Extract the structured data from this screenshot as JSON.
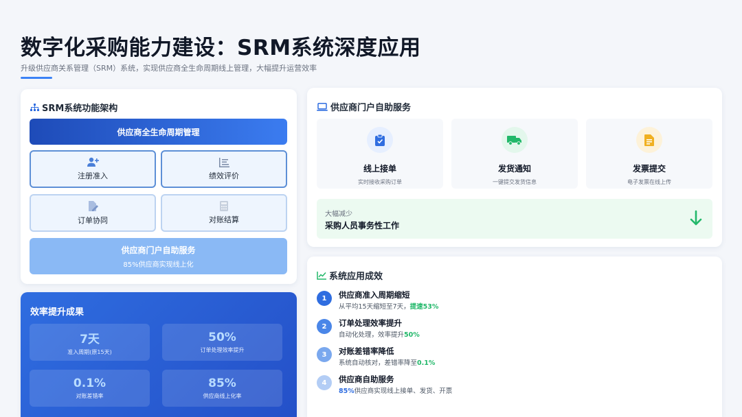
{
  "header": {
    "title": "数字化采购能力建设：SRM系统深度应用",
    "subtitle": "升级供应商关系管理（SRM）系统，实现供应商全生命周期线上管理，大幅提升运营效率"
  },
  "architecture": {
    "title": "SRM系统功能架构",
    "top_label": "供应商全生命周期管理",
    "modules": [
      {
        "label": "注册准入",
        "icon": "user-plus-icon"
      },
      {
        "label": "绩效评价",
        "icon": "list-icon"
      },
      {
        "label": "订单协同",
        "icon": "file-edit-icon"
      },
      {
        "label": "对账结算",
        "icon": "calculator-icon"
      }
    ],
    "portal_label": "供应商门户自助服务",
    "portal_sub": "85%供应商实现线上化"
  },
  "efficiency": {
    "title": "效率提升成果",
    "stats": [
      {
        "value": "7天",
        "label": "准入周期(原15天)"
      },
      {
        "value": "50%",
        "label": "订单处理效率提升"
      },
      {
        "value": "0.1%",
        "label": "对账差错率"
      },
      {
        "value": "85%",
        "label": "供应商线上化率"
      }
    ]
  },
  "portal": {
    "title": "供应商门户自助服务",
    "services": [
      {
        "name": "线上接单",
        "desc": "实时接收采购订单",
        "icon": "clipboard-check-icon",
        "color": "#2f6de0",
        "bg": "#e6efff"
      },
      {
        "name": "发货通知",
        "desc": "一键提交发货信息",
        "icon": "truck-icon",
        "color": "#22b86a",
        "bg": "#e3f7ec"
      },
      {
        "name": "发票提交",
        "desc": "电子发票在线上传",
        "icon": "invoice-icon",
        "color": "#f0b020",
        "bg": "#fdf2d9"
      }
    ],
    "reduce_small": "大幅减少",
    "reduce_big": "采购人员事务性工作"
  },
  "results": {
    "title": "系统应用成效",
    "items": [
      {
        "num": "1",
        "heading": "供应商准入周期缩短",
        "desc_pre": "从平均15天缩短至7天，",
        "desc_hl": "提速53%",
        "desc_post": ""
      },
      {
        "num": "2",
        "heading": "订单处理效率提升",
        "desc_pre": "自动化处理，效率提升",
        "desc_hl": "50%",
        "desc_post": ""
      },
      {
        "num": "3",
        "heading": "对账差错率降低",
        "desc_pre": "系统自动核对，差错率降至",
        "desc_hl": "0.1%",
        "desc_post": ""
      },
      {
        "num": "4",
        "heading": "供应商自助服务",
        "desc_pre": "",
        "desc_hl": "85%",
        "desc_post": "供应商实现线上接单、发货、开票"
      }
    ],
    "num_colors": [
      "#2f6de0",
      "#4a86e8",
      "#7aa8ee",
      "#b3cdf5"
    ]
  },
  "colors": {
    "accent": "#3b82f6",
    "green": "#22b86a"
  }
}
